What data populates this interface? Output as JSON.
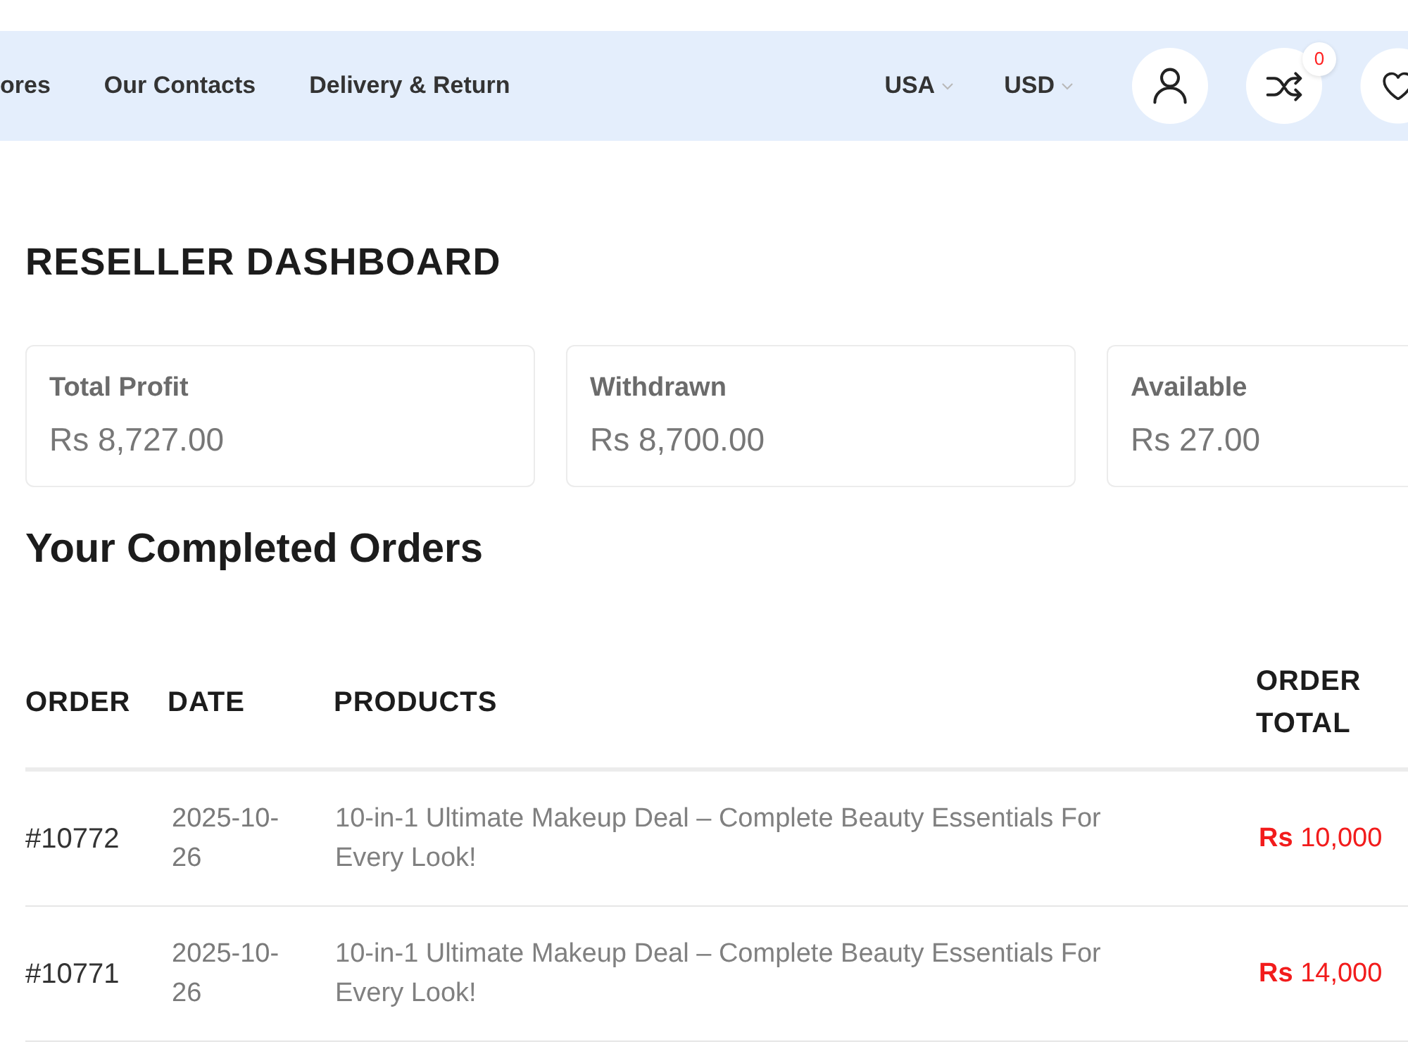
{
  "nav": {
    "links": [
      "ores",
      "Our Contacts",
      "Delivery & Return"
    ],
    "selectors": [
      "USA",
      "USD"
    ],
    "actions": [
      {
        "kind": "account"
      },
      {
        "kind": "compare",
        "badge": "0"
      },
      {
        "kind": "wishlist"
      }
    ]
  },
  "page_title": "RESELLER DASHBOARD",
  "stats": [
    {
      "label": "Total Profit",
      "value": "Rs 8,727.00"
    },
    {
      "label": "Withdrawn",
      "value": "Rs 8,700.00"
    },
    {
      "label": "Available",
      "value": "Rs 27.00"
    }
  ],
  "orders": {
    "title": "Your Completed Orders",
    "columns": [
      "ORDER",
      "DATE",
      "PRODUCTS",
      "ORDER TOTAL"
    ],
    "rows": [
      {
        "order": "#10772",
        "date": "2025-10-26",
        "product": "10-in-1 Ultimate Makeup Deal – Complete Beauty Essentials For Every Look!",
        "total": "**Rs** 10,000"
      },
      {
        "order": "#10771",
        "date": "2025-10-26",
        "product": "10-in-1 Ultimate Makeup Deal – Complete Beauty Essentials For Every Look!",
        "total": "**Rs** 14,000"
      }
    ]
  }
}
